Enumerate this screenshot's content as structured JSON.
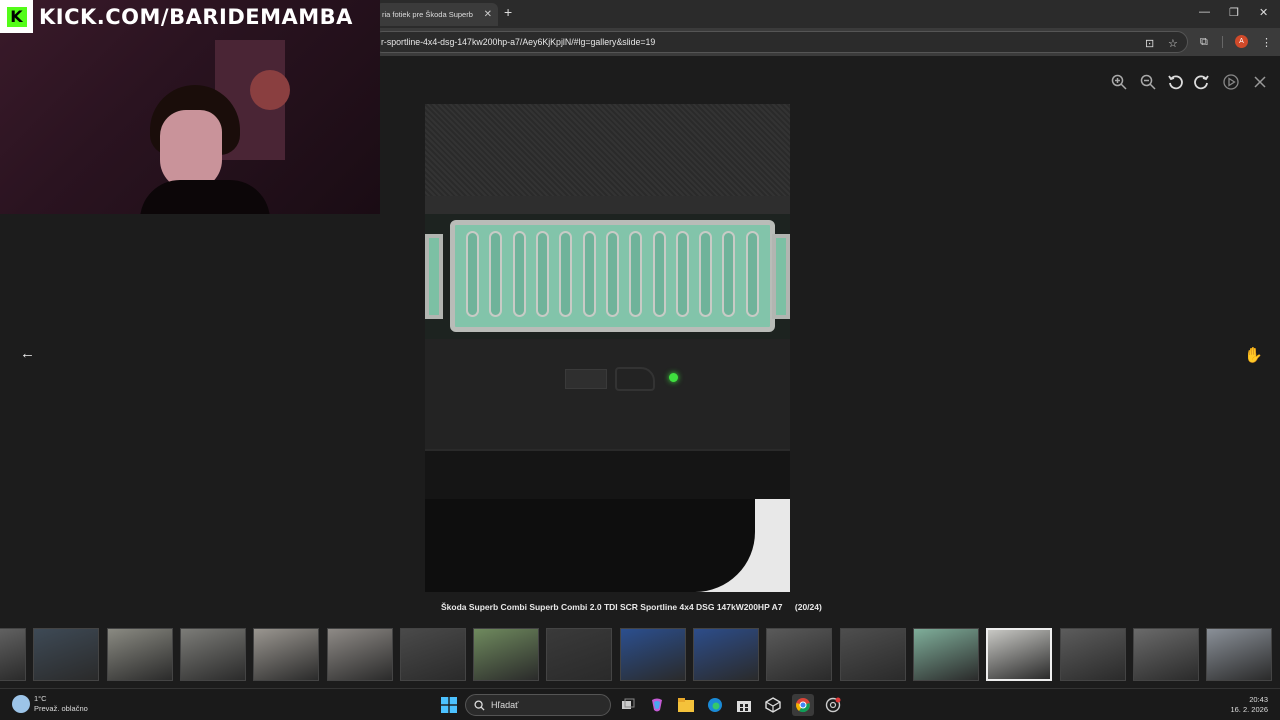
{
  "browser": {
    "tab_title": "ria fotiek pre Škoda Superb",
    "url": "r-sportline-4x4-dsg-147kw200hp-a7/Aey6KjKpjlN/#lg=gallery&slide=19",
    "profile_initial": "A",
    "new_tab_glyph": "+",
    "close_glyph": "✕",
    "minimize_glyph": "—",
    "maximize_glyph": "❐",
    "star_glyph": "☆",
    "menu_glyph": "⋮",
    "extensions_glyph": "⧉",
    "install_glyph": "⊡"
  },
  "stream": {
    "overlay_text": "KICK.COM/BARIDEMAMBA",
    "logo_letter": "K",
    "brand_color": "#53fc18"
  },
  "lightbox": {
    "caption": "Škoda Superb Combi Superb Combi 2.0 TDI SCR Sportline 4x4 DSG 147kW200HP A7",
    "counter": "(20/24)",
    "prev_glyph": "←",
    "next_glyph": "✋",
    "toolbar_icons": [
      "zoom-in-icon",
      "zoom-out-icon",
      "rotate-left-icon",
      "rotate-right-icon",
      "play-icon",
      "close-icon"
    ],
    "active_thumbnail_index": 13,
    "thumbnail_count": 18,
    "thumbnail_colors": [
      "#6e6e6e",
      "#3e4a56",
      "#8a8a82",
      "#7c7c78",
      "#9a9690",
      "#8e8a86",
      "#4a4a4a",
      "#6f8a5e",
      "#3a3a3a",
      "#2b4f8f",
      "#2d4d8a",
      "#5a5a5a",
      "#4e4e4e",
      "#7fae9a",
      "#c8c8c4",
      "#5c5c5c",
      "#6a6a6a",
      "#8a9098"
    ]
  },
  "taskbar": {
    "temperature": "1°C",
    "weather": "Prevaž. oblačno",
    "search_label": "Hľadať",
    "time": "20:43",
    "date": "16. 2. 2026"
  }
}
